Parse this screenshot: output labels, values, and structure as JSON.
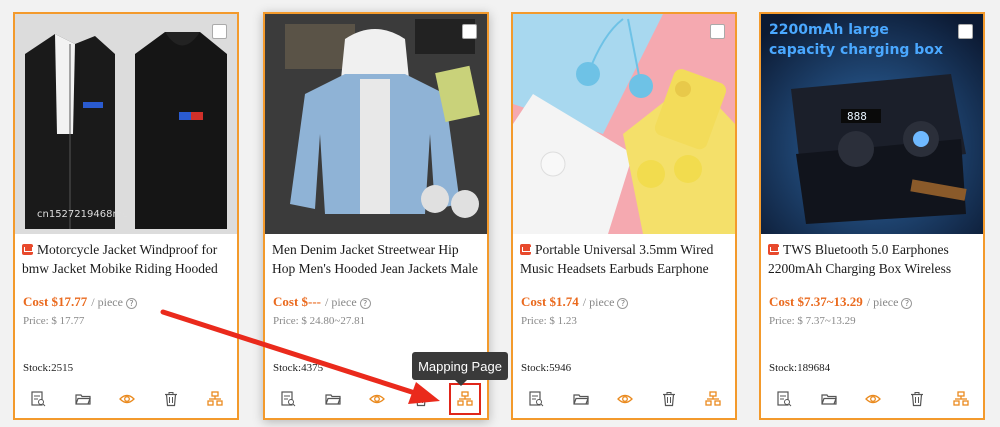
{
  "accent_color": "#f39a2c",
  "cost_color": "#ea6a1e",
  "highlight_color": "#e0261a",
  "products": [
    {
      "title": "Motorcycle Jacket Windproof for bmw Jacket Mobike Riding Hooded Jacket",
      "cost": "Cost $17.77",
      "unit": "/ piece",
      "price": "Price: $ 17.77",
      "stock": "Stock:2515",
      "image_text": "cn1527219468mo"
    },
    {
      "title": "Men Denim Jacket Streetwear Hip Hop Men's Hooded Jean Jackets Male Casual",
      "cost": "Cost $---",
      "unit": "/ piece",
      "price": "Price: $ 24.80~27.81",
      "stock": "Stock:4375",
      "image_text": ""
    },
    {
      "title": "Portable Universal 3.5mm Wired Music Headsets Earbuds Earphone With Mic",
      "cost": "Cost $1.74",
      "unit": "/ piece",
      "price": "Price: $ 1.23",
      "stock": "Stock:5946",
      "image_text": ""
    },
    {
      "title": "TWS Bluetooth 5.0 Earphones 2200mAh Charging Box Wireless Headphones",
      "cost": "Cost $7.37~13.29",
      "unit": "/ piece",
      "price": "Price: $ 7.37~13.29",
      "stock": "Stock:189684",
      "image_text": "2200mAh large capacity charging box"
    }
  ],
  "actions": [
    "details-icon",
    "folder-icon",
    "eye-icon",
    "trash-icon",
    "mapping-icon"
  ],
  "tooltip": "Mapping Page",
  "help_glyph": "?"
}
